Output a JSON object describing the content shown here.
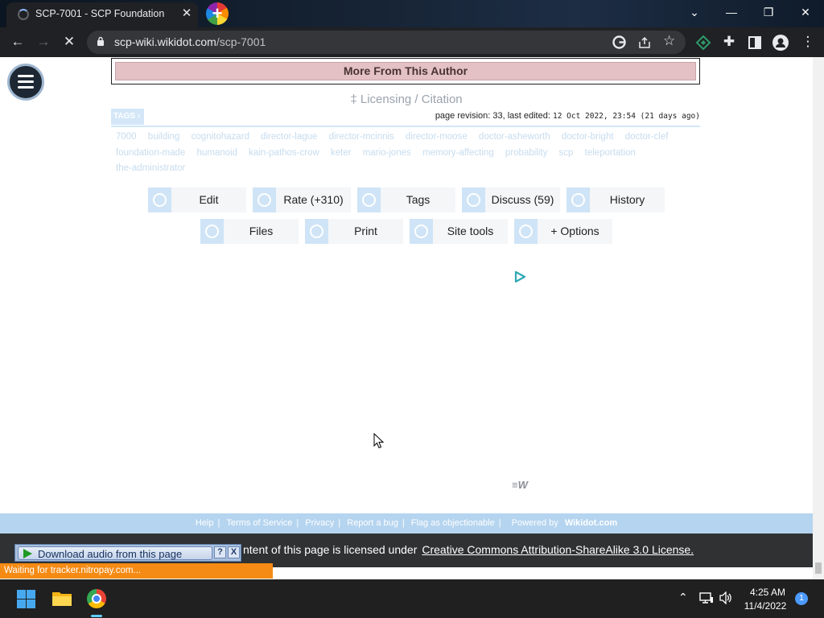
{
  "browser": {
    "tab_title": "SCP-7001 - SCP Foundation",
    "tab_close": "✕",
    "url_host": "scp-wiki.wikidot.com",
    "url_path": "/scp-7001",
    "window_controls": {
      "dropdown": "⌄",
      "minimize": "—",
      "restore": "❐",
      "close": "✕"
    }
  },
  "page": {
    "more_from_author": "More From This Author",
    "licensing": "‡ Licensing / Citation",
    "tags_badge": "TAGS",
    "revision_prefix": "page revision: 33, last edited:",
    "revision_date": "12 Oct 2022, 23:54 (21 days ago)",
    "tags": [
      "7000",
      "building",
      "cognitohazard",
      "director-lague",
      "director-mcinnis",
      "director-moose",
      "doctor-asheworth",
      "doctor-bright",
      "doctor-clef",
      "foundation-made",
      "humanoid",
      "kain-pathos-crow",
      "keter",
      "mario-jones",
      "memory-affecting",
      "probability",
      "scp",
      "teleportation",
      "the-administrator"
    ],
    "actions_row1": [
      "Edit",
      "Rate (+310)",
      "Tags",
      "Discuss (59)",
      "History"
    ],
    "actions_row2": [
      "Files",
      "Print",
      "Site tools",
      "+ Options"
    ],
    "footer_links": [
      "Help",
      "Terms of Service",
      "Privacy",
      "Report a bug",
      "Flag as objectionable"
    ],
    "powered_by_prefix": "Powered by",
    "powered_by_brand": "Wikidot.com",
    "license_text": "ntent of this page is licensed under",
    "license_link": "Creative Commons Attribution-ShareAlike 3.0 License.",
    "audio_label": "Download audio from this page",
    "audio_help": "?",
    "audio_close": "X",
    "status_text": "Waiting for tracker.nitropay.com..."
  },
  "taskbar": {
    "time": "4:25 AM",
    "date": "11/4/2022",
    "notification_count": "1"
  }
}
